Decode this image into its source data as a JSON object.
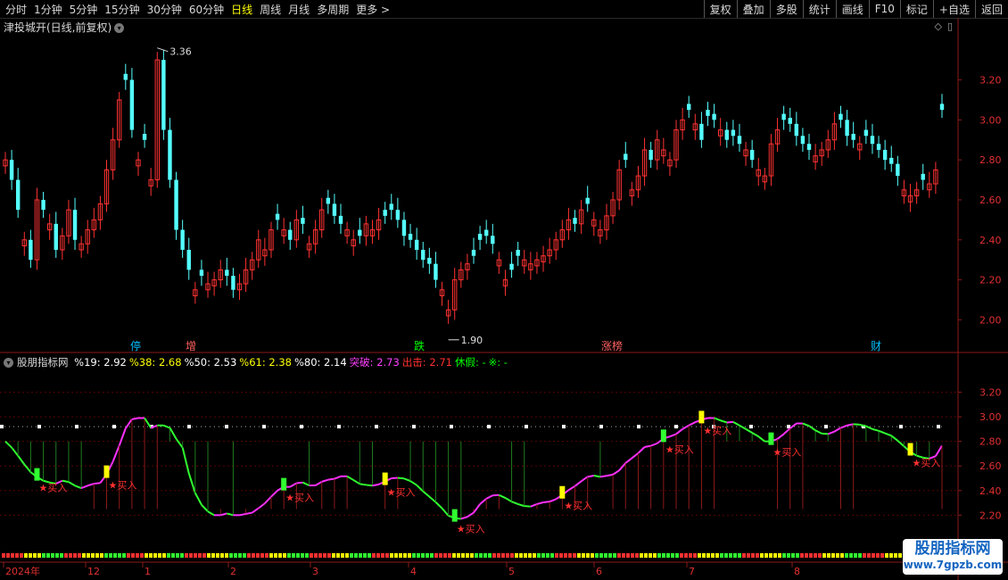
{
  "toolbar": {
    "periods": [
      "分时",
      "1分钟",
      "5分钟",
      "15分钟",
      "30分钟",
      "60分钟",
      "日线",
      "周线",
      "月线",
      "多周期",
      "更多 >"
    ],
    "active_period": "日线",
    "right_buttons": [
      "复权",
      "叠加",
      "多股",
      "统计",
      "画线",
      "F10",
      "标记",
      "+自选",
      "返回"
    ]
  },
  "main_panel": {
    "title": "津投城开(日线,前复权)",
    "high_label": "3.36",
    "low_label": "1.90",
    "event_tags": [
      {
        "text": "停",
        "color": "#00bfff"
      },
      {
        "text": "增",
        "color": "#ff6060"
      },
      {
        "text": "跌",
        "color": "#00ff00"
      },
      {
        "text": "涨榜",
        "color": "#ff6060"
      },
      {
        "text": "财",
        "color": "#00bfff"
      }
    ],
    "y_ticks": [
      "3.20",
      "3.00",
      "2.80",
      "2.60",
      "2.40",
      "2.20",
      "2.00"
    ],
    "y_range": [
      1.85,
      3.43
    ],
    "candle_closes": [
      2.8,
      2.7,
      2.55,
      2.4,
      2.3,
      2.6,
      2.55,
      2.48,
      2.35,
      2.42,
      2.55,
      2.4,
      2.38,
      2.45,
      2.5,
      2.58,
      2.75,
      2.9,
      3.1,
      3.2,
      2.95,
      2.8,
      2.9,
      2.7,
      3.3,
      2.95,
      2.7,
      2.45,
      2.35,
      2.25,
      2.15,
      2.22,
      2.18,
      2.2,
      2.25,
      2.22,
      2.15,
      2.18,
      2.25,
      2.3,
      2.4,
      2.35,
      2.45,
      2.5,
      2.45,
      2.4,
      2.5,
      2.48,
      2.38,
      2.45,
      2.55,
      2.58,
      2.52,
      2.48,
      2.45,
      2.4,
      2.42,
      2.48,
      2.45,
      2.5,
      2.52,
      2.55,
      2.5,
      2.42,
      2.4,
      2.35,
      2.3,
      2.28,
      2.2,
      2.15,
      2.05,
      2.2,
      2.25,
      2.28,
      2.32,
      2.4,
      2.42,
      2.38,
      2.3,
      2.2,
      2.25,
      2.32,
      2.3,
      2.28,
      2.3,
      2.32,
      2.35,
      2.4,
      2.45,
      2.5,
      2.48,
      2.55,
      2.58,
      2.5,
      2.45,
      2.52,
      2.6,
      2.75,
      2.8,
      2.65,
      2.72,
      2.85,
      2.8,
      2.9,
      2.85,
      2.8,
      2.95,
      3.0,
      3.05,
      2.98,
      2.9,
      3.02,
      3.0,
      2.95,
      2.9,
      2.92,
      2.88,
      2.85,
      2.8,
      2.75,
      2.72,
      2.88,
      2.95,
      3.0,
      2.98,
      2.92,
      2.88,
      2.85,
      2.82,
      2.85,
      2.9,
      2.98,
      3.0,
      2.92,
      2.9,
      2.88,
      2.92,
      2.88,
      2.85,
      2.8,
      2.78,
      2.72,
      2.65,
      2.62,
      2.65,
      2.7,
      2.68,
      2.75,
      3.05
    ],
    "candle_dirs": "rggrgrgrgrrgrrrrrrrggrgrrgggggrgrrrggrrrrrrgrgrgrrrgggrrgrrrgggggggggrrrrrggggrrggrrrrrrrrgrgrrrrrgrrrgrrrrrgrgggrgggrgrrrrgggggrrrrgggrggggggrrrgrr"
  },
  "indicator_panel": {
    "title": "股朋指标网",
    "stats": [
      {
        "text": "%19: 2.92",
        "color": "#ffffff"
      },
      {
        "text": "%38: 2.68",
        "color": "#ffff00"
      },
      {
        "text": "%50: 2.53",
        "color": "#ffffff"
      },
      {
        "text": "%61: 2.38",
        "color": "#ffff00"
      },
      {
        "text": "%80: 2.14",
        "color": "#ffffff"
      },
      {
        "text": "突破: 2.73",
        "color": "#ff40ff"
      },
      {
        "text": "出击: 2.71",
        "color": "#ff3030"
      },
      {
        "text": "休假: -",
        "color": "#00ff00"
      },
      {
        "text": "※: -",
        "color": "#00ff00"
      }
    ],
    "y_ticks": [
      "3.20",
      "3.00",
      "2.80",
      "2.60",
      "2.40",
      "2.20"
    ],
    "y_range": [
      2.05,
      3.4
    ],
    "buy_label": "★买入",
    "buy_signals": [
      1,
      3,
      8,
      11,
      13,
      16,
      19,
      20,
      22,
      26
    ],
    "resistance_level": 2.92
  },
  "time_axis": {
    "labels": [
      "2024年",
      "12",
      "1",
      "2",
      "3",
      "4",
      "5",
      "6",
      "7",
      "8"
    ]
  },
  "watermark": {
    "line1": "股朋指标网",
    "line2": "www.7gpzb.com"
  },
  "colors": {
    "up": "#ff3232",
    "down": "#54ffff",
    "axis": "#8b1a1a",
    "grid": "#5a0000"
  }
}
